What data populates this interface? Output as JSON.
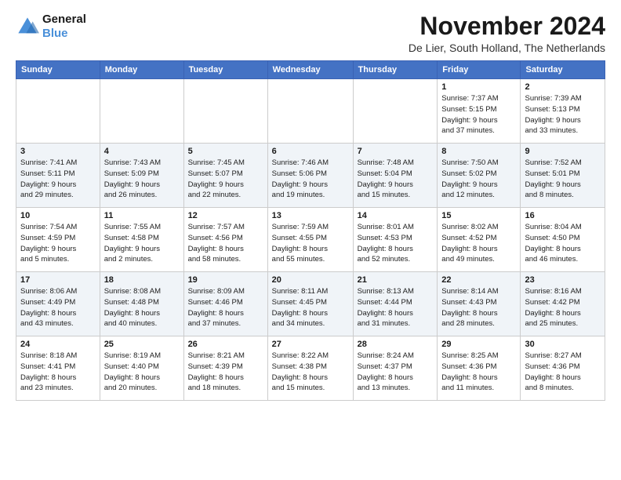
{
  "logo": {
    "line1": "General",
    "line2": "Blue"
  },
  "title": "November 2024",
  "location": "De Lier, South Holland, The Netherlands",
  "weekdays": [
    "Sunday",
    "Monday",
    "Tuesday",
    "Wednesday",
    "Thursday",
    "Friday",
    "Saturday"
  ],
  "weeks": [
    [
      {
        "day": "",
        "info": ""
      },
      {
        "day": "",
        "info": ""
      },
      {
        "day": "",
        "info": ""
      },
      {
        "day": "",
        "info": ""
      },
      {
        "day": "",
        "info": ""
      },
      {
        "day": "1",
        "info": "Sunrise: 7:37 AM\nSunset: 5:15 PM\nDaylight: 9 hours\nand 37 minutes."
      },
      {
        "day": "2",
        "info": "Sunrise: 7:39 AM\nSunset: 5:13 PM\nDaylight: 9 hours\nand 33 minutes."
      }
    ],
    [
      {
        "day": "3",
        "info": "Sunrise: 7:41 AM\nSunset: 5:11 PM\nDaylight: 9 hours\nand 29 minutes."
      },
      {
        "day": "4",
        "info": "Sunrise: 7:43 AM\nSunset: 5:09 PM\nDaylight: 9 hours\nand 26 minutes."
      },
      {
        "day": "5",
        "info": "Sunrise: 7:45 AM\nSunset: 5:07 PM\nDaylight: 9 hours\nand 22 minutes."
      },
      {
        "day": "6",
        "info": "Sunrise: 7:46 AM\nSunset: 5:06 PM\nDaylight: 9 hours\nand 19 minutes."
      },
      {
        "day": "7",
        "info": "Sunrise: 7:48 AM\nSunset: 5:04 PM\nDaylight: 9 hours\nand 15 minutes."
      },
      {
        "day": "8",
        "info": "Sunrise: 7:50 AM\nSunset: 5:02 PM\nDaylight: 9 hours\nand 12 minutes."
      },
      {
        "day": "9",
        "info": "Sunrise: 7:52 AM\nSunset: 5:01 PM\nDaylight: 9 hours\nand 8 minutes."
      }
    ],
    [
      {
        "day": "10",
        "info": "Sunrise: 7:54 AM\nSunset: 4:59 PM\nDaylight: 9 hours\nand 5 minutes."
      },
      {
        "day": "11",
        "info": "Sunrise: 7:55 AM\nSunset: 4:58 PM\nDaylight: 9 hours\nand 2 minutes."
      },
      {
        "day": "12",
        "info": "Sunrise: 7:57 AM\nSunset: 4:56 PM\nDaylight: 8 hours\nand 58 minutes."
      },
      {
        "day": "13",
        "info": "Sunrise: 7:59 AM\nSunset: 4:55 PM\nDaylight: 8 hours\nand 55 minutes."
      },
      {
        "day": "14",
        "info": "Sunrise: 8:01 AM\nSunset: 4:53 PM\nDaylight: 8 hours\nand 52 minutes."
      },
      {
        "day": "15",
        "info": "Sunrise: 8:02 AM\nSunset: 4:52 PM\nDaylight: 8 hours\nand 49 minutes."
      },
      {
        "day": "16",
        "info": "Sunrise: 8:04 AM\nSunset: 4:50 PM\nDaylight: 8 hours\nand 46 minutes."
      }
    ],
    [
      {
        "day": "17",
        "info": "Sunrise: 8:06 AM\nSunset: 4:49 PM\nDaylight: 8 hours\nand 43 minutes."
      },
      {
        "day": "18",
        "info": "Sunrise: 8:08 AM\nSunset: 4:48 PM\nDaylight: 8 hours\nand 40 minutes."
      },
      {
        "day": "19",
        "info": "Sunrise: 8:09 AM\nSunset: 4:46 PM\nDaylight: 8 hours\nand 37 minutes."
      },
      {
        "day": "20",
        "info": "Sunrise: 8:11 AM\nSunset: 4:45 PM\nDaylight: 8 hours\nand 34 minutes."
      },
      {
        "day": "21",
        "info": "Sunrise: 8:13 AM\nSunset: 4:44 PM\nDaylight: 8 hours\nand 31 minutes."
      },
      {
        "day": "22",
        "info": "Sunrise: 8:14 AM\nSunset: 4:43 PM\nDaylight: 8 hours\nand 28 minutes."
      },
      {
        "day": "23",
        "info": "Sunrise: 8:16 AM\nSunset: 4:42 PM\nDaylight: 8 hours\nand 25 minutes."
      }
    ],
    [
      {
        "day": "24",
        "info": "Sunrise: 8:18 AM\nSunset: 4:41 PM\nDaylight: 8 hours\nand 23 minutes."
      },
      {
        "day": "25",
        "info": "Sunrise: 8:19 AM\nSunset: 4:40 PM\nDaylight: 8 hours\nand 20 minutes."
      },
      {
        "day": "26",
        "info": "Sunrise: 8:21 AM\nSunset: 4:39 PM\nDaylight: 8 hours\nand 18 minutes."
      },
      {
        "day": "27",
        "info": "Sunrise: 8:22 AM\nSunset: 4:38 PM\nDaylight: 8 hours\nand 15 minutes."
      },
      {
        "day": "28",
        "info": "Sunrise: 8:24 AM\nSunset: 4:37 PM\nDaylight: 8 hours\nand 13 minutes."
      },
      {
        "day": "29",
        "info": "Sunrise: 8:25 AM\nSunset: 4:36 PM\nDaylight: 8 hours\nand 11 minutes."
      },
      {
        "day": "30",
        "info": "Sunrise: 8:27 AM\nSunset: 4:36 PM\nDaylight: 8 hours\nand 8 minutes."
      }
    ]
  ]
}
